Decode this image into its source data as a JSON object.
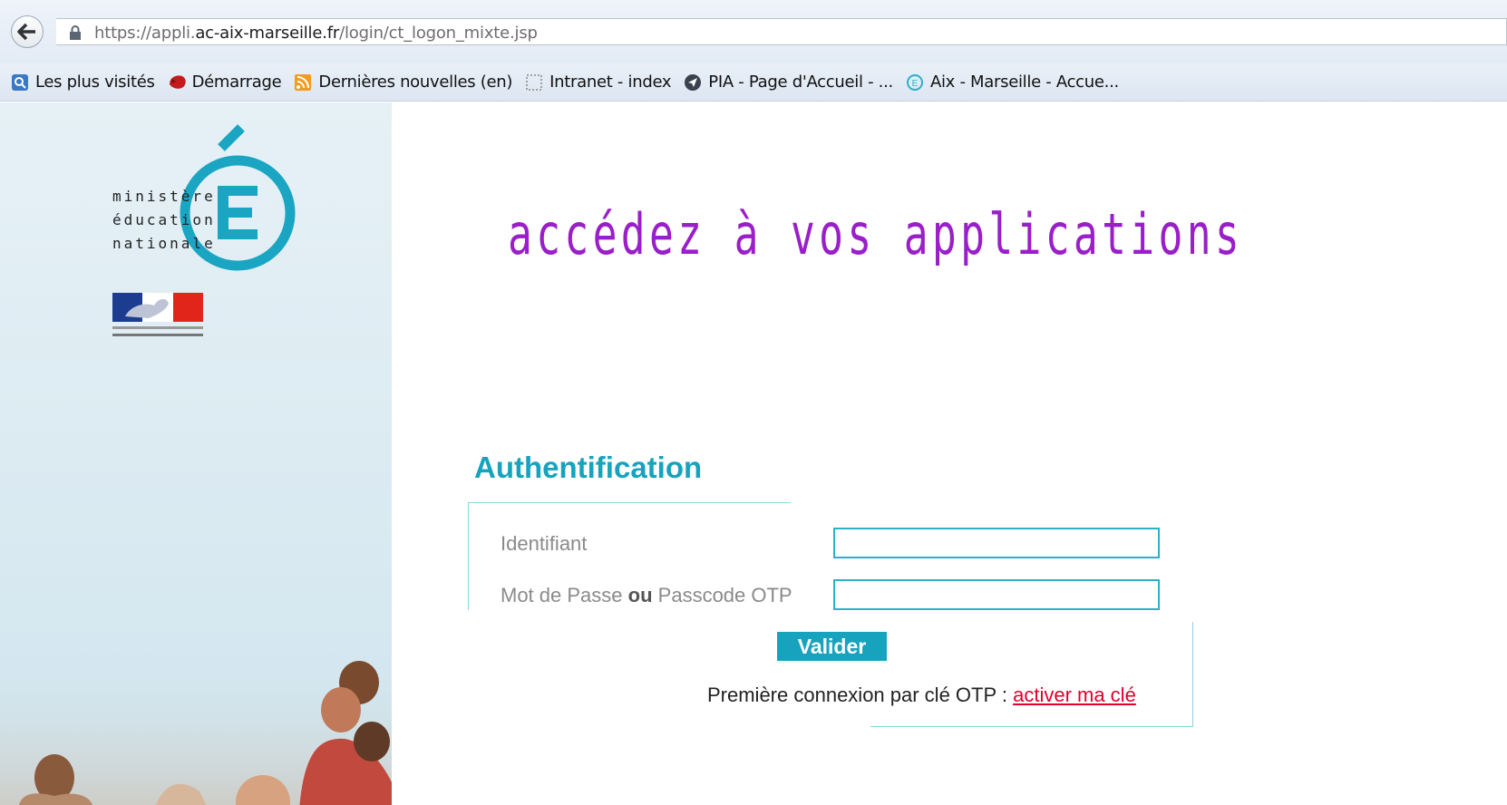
{
  "browser": {
    "url_prefix": "https://appli.",
    "url_domain": "ac-aix-marseille.fr",
    "url_path": "/login/ct_logon_mixte.jsp",
    "bookmarks": [
      {
        "label": "Les plus visités",
        "icon": "most-visited-icon"
      },
      {
        "label": "Démarrage",
        "icon": "firefox-icon"
      },
      {
        "label": "Dernières nouvelles (en)",
        "icon": "rss-icon"
      },
      {
        "label": "Intranet - index",
        "icon": "page-icon"
      },
      {
        "label": "PIA - Page d'Accueil - ...",
        "icon": "globe-icon"
      },
      {
        "label": "Aix - Marseille - Accue...",
        "icon": "education-icon"
      }
    ]
  },
  "sidebar": {
    "logo_lines": [
      "ministère",
      "éducation",
      "nationale"
    ]
  },
  "main": {
    "headline": "accédez à vos applications",
    "auth_title": "Authentification",
    "username_label": "Identifiant",
    "password_label_1": "Mot de Passe",
    "password_label_or": "ou",
    "password_label_2": "Passcode OTP",
    "username_value": "",
    "password_value": "",
    "submit_label": "Valider",
    "otp_text": "Première connexion par clé OTP : ",
    "otp_link": "activer ma clé"
  },
  "colors": {
    "accent": "#17a3be",
    "headline": "#9a1ec9",
    "link": "#e0002a"
  }
}
